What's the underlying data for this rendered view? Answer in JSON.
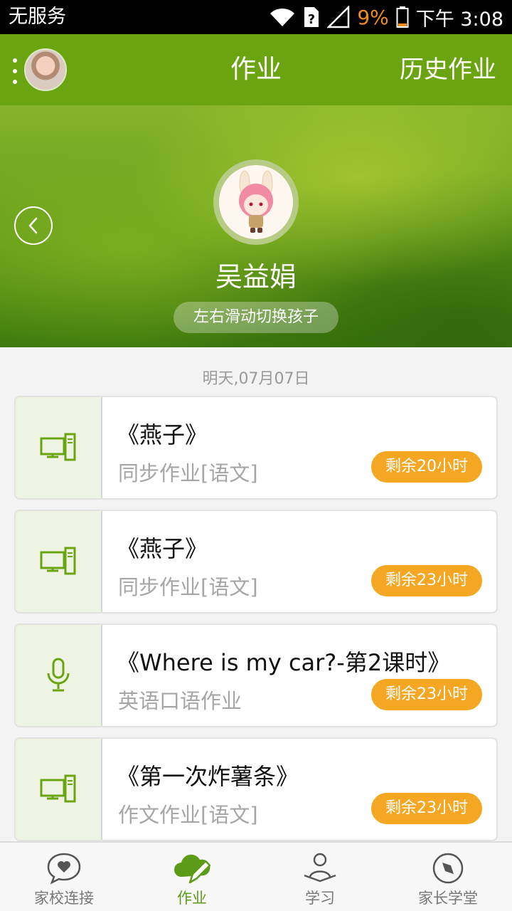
{
  "status_bar": {
    "carrier": "无服务",
    "battery_percent": "9%",
    "time": "下午 3:08",
    "icons": [
      "wifi-icon",
      "sim-unknown-icon",
      "signal-icon",
      "battery-low-icon"
    ]
  },
  "header": {
    "title": "作业",
    "history_label": "历史作业"
  },
  "banner": {
    "child_name": "吴益娟",
    "swipe_hint": "左右滑动切换孩子"
  },
  "homework": {
    "date_label": "明天,07月07日",
    "items": [
      {
        "title": "《燕子》",
        "subtitle": "同步作业[语文]",
        "remaining": "剩余20小时",
        "icon": "computer-icon"
      },
      {
        "title": "《燕子》",
        "subtitle": "同步作业[语文]",
        "remaining": "剩余23小时",
        "icon": "computer-icon"
      },
      {
        "title": "《Where is my car?-第2课时》",
        "subtitle": "英语口语作业",
        "remaining": "剩余23小时",
        "icon": "microphone-icon"
      },
      {
        "title": "《第一次炸薯条》",
        "subtitle": "作文作业[语文]",
        "remaining": "剩余23小时",
        "icon": "computer-icon"
      }
    ]
  },
  "bottom_nav": {
    "items": [
      {
        "label": "家校连接",
        "icon": "heart-chat-icon"
      },
      {
        "label": "作业",
        "icon": "cloud-pencil-icon"
      },
      {
        "label": "学习",
        "icon": "reading-person-icon"
      },
      {
        "label": "家长学堂",
        "icon": "compass-icon"
      }
    ],
    "active_index": 1
  },
  "colors": {
    "brand_green": "#6aa511",
    "badge_orange": "#f5a623",
    "battery_warning": "#f28b1d"
  }
}
